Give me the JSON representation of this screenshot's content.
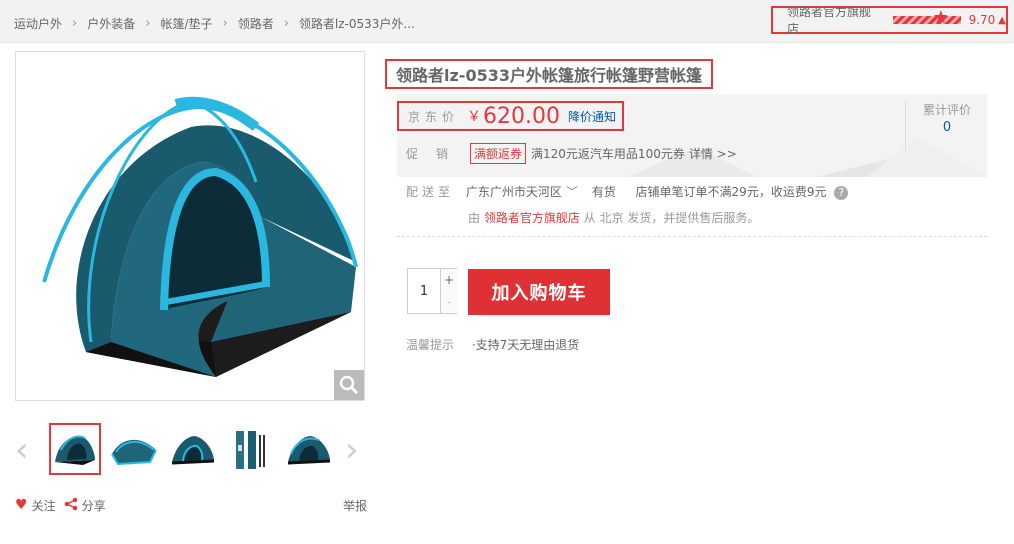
{
  "breadcrumb": [
    "运动户外",
    "户外装备",
    "帐篷/垫子",
    "领路者",
    "领路者lz-0533户外..."
  ],
  "store": {
    "name": "领路者官方旗舰店",
    "score": "9.70",
    "trend_icon": "arrow-up-icon",
    "rating_fraction": 0.97
  },
  "product": {
    "title": "领路者lz-0533户外帐篷旅行帐篷野营帐篷",
    "price_label": "京东价",
    "currency": "￥",
    "price": "620.00",
    "price_notify": "降价通知",
    "review_label": "累计评价",
    "review_count": "0",
    "promo_label": "促销",
    "promo_tag": "满额返券",
    "promo_text": "满120元返汽车用品100元券",
    "promo_more": "详情 >>",
    "delivery_label": "配送至",
    "delivery_region": "广东广州市天河区",
    "stock": "有货",
    "shipping_fee": "店铺单笔订单不满29元，收运费9元",
    "ship_prefix": "由",
    "ship_store": "领路者官方旗舰店",
    "ship_suffix": "从 北京 发货，并提供售后服务。",
    "quantity": "1",
    "add_to_cart": "加入购物车",
    "tips_label": "温馨提示",
    "tips_item": "·支持7天无理由退货"
  },
  "gallery": {
    "thumb_count": 5,
    "selected_index": 0
  },
  "actions": {
    "follow": "关注",
    "share": "分享",
    "report": "举报"
  },
  "colors": {
    "accent": "#e4393c",
    "link": "#005aa0",
    "tent": "#1b5f73",
    "tent_light": "#2bb0d6"
  }
}
